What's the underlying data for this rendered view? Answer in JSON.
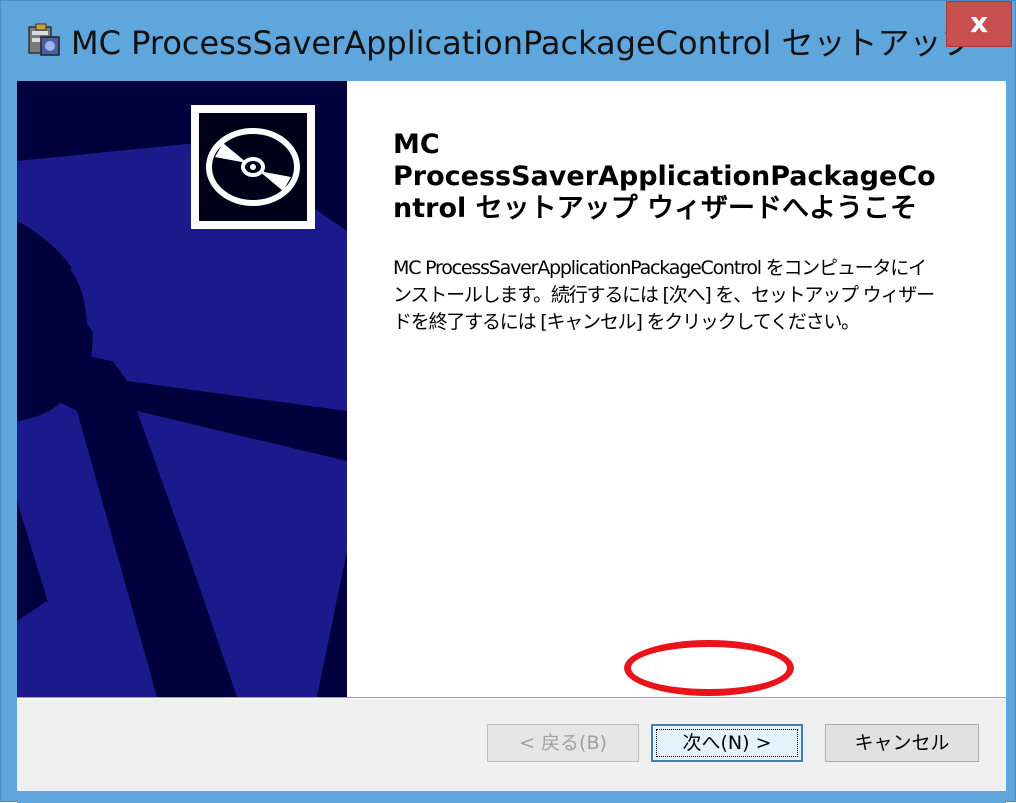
{
  "window": {
    "title": "MC ProcessSaverApplicationPackageControl セットアップ",
    "close_label": "x"
  },
  "welcome": {
    "heading_lines": [
      "MC",
      "ProcessSaverApplicationPackageCo",
      "ntrol セットアップ ウィザードへようこそ"
    ],
    "body_lines": [
      "MC ProcessSaverApplicationPackageControl をコンピュータにイ",
      "ンストールします。続行するには [次へ] を、セットアップ ウィザー",
      "ドを終了するには [キャンセル] をクリックしてください。"
    ]
  },
  "buttons": {
    "back": "< 戻る(B)",
    "next": "次へ(N) >",
    "cancel": "キャンセル"
  },
  "colors": {
    "titlebar": "#5ea6dc",
    "banner": "#00003c",
    "banner_shape": "#1a1a8c",
    "highlight": "#e8131b"
  }
}
